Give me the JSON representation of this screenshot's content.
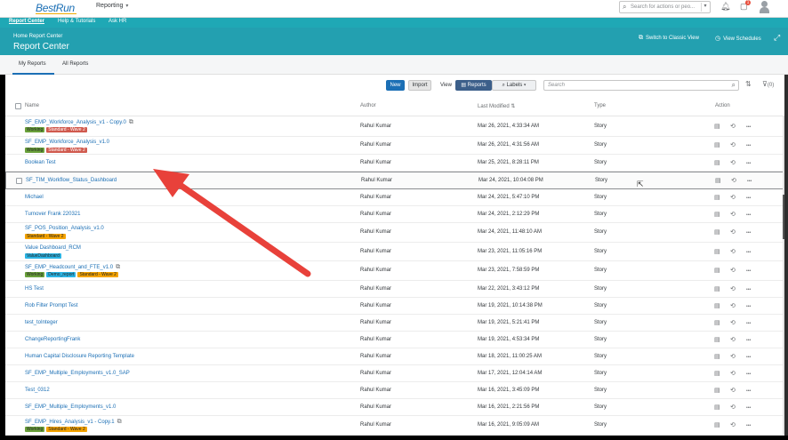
{
  "shell": {
    "logo": "BestRun",
    "menu_label": "Reporting",
    "search_placeholder": "Search for actions or peo...",
    "notification_count": "1"
  },
  "subnav": {
    "items": [
      "Report Center",
      "Help & Tutorials",
      "Ask HR"
    ]
  },
  "header": {
    "breadcrumb": "Home  Report Center",
    "title": "Report Center",
    "switch_classic": "Switch to Classic View",
    "view_schedules": "View Schedules"
  },
  "tabs": {
    "my_reports": "My Reports",
    "all_reports": "All Reports"
  },
  "toolbar": {
    "new": "New",
    "import": "Import",
    "view_label": "View",
    "reports": "Reports",
    "labels": "Labels",
    "search_placeholder": "Search",
    "filter_count": "(0)"
  },
  "table": {
    "headers": {
      "name": "Name",
      "author": "Author",
      "last_modified": "Last Modified",
      "type": "Type",
      "action": "Action"
    },
    "rows": [
      {
        "name": "SF_EMP_Workforce_Analysis_v1 - Copy.0",
        "author": "Rahul Kumar",
        "modified": "Mar 26, 2021, 4:33:34 AM",
        "type": "Story"
      },
      {
        "name": "SF_EMP_Workforce_Analysis_v1.0",
        "author": "Rahul Kumar",
        "modified": "Mar 26, 2021, 4:31:56 AM",
        "type": "Story"
      },
      {
        "name": "Boolean Test",
        "author": "Rahul Kumar",
        "modified": "Mar 25, 2021, 8:28:11 PM",
        "type": "Story"
      },
      {
        "name": "SF_TIM_Workflow_Status_Dashboard",
        "author": "Rahul Kumar",
        "modified": "Mar 24, 2021, 10:04:08 PM",
        "type": "Story"
      },
      {
        "name": "Michael",
        "author": "Rahul Kumar",
        "modified": "Mar 24, 2021, 5:47:10 PM",
        "type": "Story"
      },
      {
        "name": "Turnover Frank 220321",
        "author": "Rahul Kumar",
        "modified": "Mar 24, 2021, 2:12:29 PM",
        "type": "Story"
      },
      {
        "name": "SF_POS_Position_Analysis_v1.0",
        "author": "Rahul Kumar",
        "modified": "Mar 24, 2021, 11:48:10 AM",
        "type": "Story"
      },
      {
        "name": "Value Dashboard_RCM",
        "author": "Rahul Kumar",
        "modified": "Mar 23, 2021, 11:05:16 PM",
        "type": "Story"
      },
      {
        "name": "SF_EMP_Headcount_and_FTE_v1.0",
        "author": "Rahul Kumar",
        "modified": "Mar 23, 2021, 7:58:59 PM",
        "type": "Story"
      },
      {
        "name": "HS Test",
        "author": "Rahul Kumar",
        "modified": "Mar 22, 2021, 3:43:12 PM",
        "type": "Story"
      },
      {
        "name": "Rob Filter Prompt Test",
        "author": "Rahul Kumar",
        "modified": "Mar 19, 2021, 10:14:38 PM",
        "type": "Story"
      },
      {
        "name": "test_toInteger",
        "author": "Rahul Kumar",
        "modified": "Mar 19, 2021, 5:21:41 PM",
        "type": "Story"
      },
      {
        "name": "ChangeReportingFrank",
        "author": "Rahul Kumar",
        "modified": "Mar 19, 2021, 4:53:34 PM",
        "type": "Story"
      },
      {
        "name": "Human Capital Disclosure Reporting Template",
        "author": "Rahul Kumar",
        "modified": "Mar 18, 2021, 11:00:25 AM",
        "type": "Story"
      },
      {
        "name": "SF_EMP_Multiple_Employments_v1.0_SAP",
        "author": "Rahul Kumar",
        "modified": "Mar 17, 2021, 12:04:14 AM",
        "type": "Story"
      },
      {
        "name": "Test_0312",
        "author": "Rahul Kumar",
        "modified": "Mar 16, 2021, 3:45:09 PM",
        "type": "Story"
      },
      {
        "name": "SF_EMP_Multiple_Employments_v1.0",
        "author": "Rahul Kumar",
        "modified": "Mar 16, 2021, 2:21:56 PM",
        "type": "Story"
      },
      {
        "name": "SF_EMP_Hires_Analysis_v1 - Copy.1",
        "author": "Rahul Kumar",
        "modified": "Mar 16, 2021, 9:05:09 AM",
        "type": "Story"
      }
    ],
    "tags": {
      "working": "Working",
      "standard_wave2": "Standard - Wave 2",
      "value_dashboard": "ValueDashboard",
      "demo_report": "Demo_report"
    }
  },
  "icons": [
    "search-icon",
    "bell-icon",
    "notification-icon",
    "user-avatar-icon",
    "switch-view-icon",
    "schedule-icon",
    "fullscreen-icon",
    "sort-icon",
    "filter-icon",
    "open-icon",
    "share-icon",
    "more-icon",
    "mouse-cursor-icon"
  ],
  "colors": {
    "teal": "#23a0b0",
    "link": "#1b6fb5",
    "primary_button": "#1b6fb5",
    "arrow": "#e8413a",
    "tag_green": "#6aa13b",
    "tag_red": "#d05a4e",
    "tag_orange": "#f4a300",
    "tag_cyan": "#2bb4e4"
  }
}
